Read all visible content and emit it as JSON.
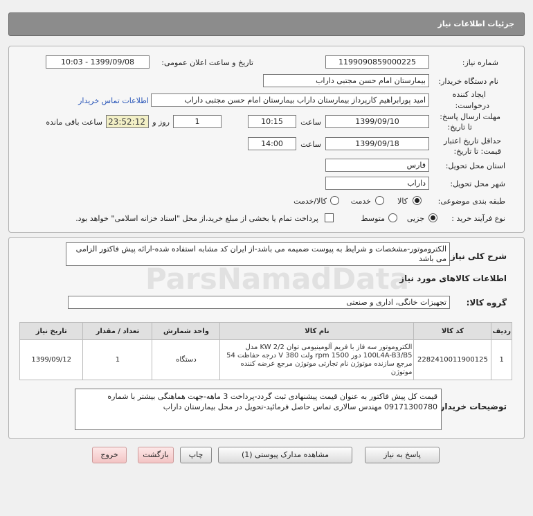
{
  "header": {
    "title": "جزئیات اطلاعات نیاز"
  },
  "form": {
    "need_number_label": "شماره نیاز:",
    "need_number": "1199090859000225",
    "announce_label": "تاریخ و ساعت اعلان عمومی:",
    "announce_value": "1399/09/08 - 10:03",
    "buyer_org_label": "نام دستگاه خریدار:",
    "buyer_org": "بیمارستان امام حسن مجتبی داراب",
    "creator_label_1": "ایجاد کننده",
    "creator_label_2": "درخواست:",
    "creator": "امید پورابراهیم کارپرداز بیمارستان داراب بیمارستان امام حسن مجتبی داراب",
    "contact_link": "اطلاعات تماس خریدار",
    "send_deadline_label_1": "مهلت ارسال پاسخ:",
    "send_deadline_label_2": "تا تاریخ:",
    "send_date": "1399/09/10",
    "time_label": "ساعت",
    "send_time": "10:15",
    "days_value": "1",
    "days_label": "روز و",
    "remaining_time": "23:52:12",
    "remaining_label": "ساعت باقی مانده",
    "validity_label_1": "حداقل تاریخ اعتبار",
    "validity_label_2": "قیمت: تا تاریخ:",
    "validity_date": "1399/09/18",
    "validity_time": "14:00",
    "province_label": "استان محل تحویل:",
    "province": "فارس",
    "city_label": "شهر محل تحویل:",
    "city": "داراب",
    "category_label": "طبقه بندی موضوعی:",
    "category_options": [
      "کالا",
      "خدمت",
      "کالا/خدمت"
    ],
    "category_selected": "کالا",
    "process_label": "نوع فرآیند خرید :",
    "process_options": [
      "جزیی",
      "متوسط"
    ],
    "process_selected": "جزیی",
    "payment_note": "پرداخت تمام یا بخشی از مبلغ خرید،از محل \"اسناد خزانه اسلامی\" خواهد بود."
  },
  "description": {
    "label": "شرح کلی نیاز:",
    "text": "الکتروموتور-مشخصات و شرایط به پیوست ضمیمه می باشد-از ایران کد مشابه استفاده شده-ارائه پیش فاکتور الزامی می باشد"
  },
  "goods": {
    "section_title": "اطلاعات کالاهای مورد نیاز",
    "group_label": "گروه کالا:",
    "group_value": "تجهیزات خانگی، اداری و صنعتی",
    "columns": [
      "ردیف",
      "کد کالا",
      "نام کالا",
      "واحد شمارش",
      "تعداد / مقدار",
      "تاریخ نیاز"
    ],
    "rows": [
      {
        "row": "1",
        "code": "2282410011900125",
        "name": "الکتروموتور سه فاز با فریم آلومینیومی توان KW 2/2 مدل 100L4A-B3/B5 دور rpm 1500 ولت V 380 درجه حفاظت 54 مرجع سازنده موتوژن نام تجارتی موتوژن مرجع عرضه کننده موتوژن",
        "unit": "دستگاه",
        "qty": "1",
        "date": "1399/09/12"
      }
    ]
  },
  "buyer_notes": {
    "label": "توضیحات خریدار:",
    "text": "قیمت کل پیش فاکتور به عنوان قیمت پیشنهادی ثبت گردد-پرداخت 3 ماهه-جهت هماهنگی بیشتر با شماره 09171300780 مهندس سالاری تماس حاصل فرمائید-تحویل در محل بیمارستان داراب"
  },
  "buttons": {
    "reply": "پاسخ به نیاز",
    "attachments": "مشاهده مدارک پیوستی (1)",
    "print": "چاپ",
    "back": "بازگشت",
    "exit": "خروج"
  },
  "watermark": {
    "text": "ParsNamadData"
  },
  "colors": {
    "header_bg": "#8c8c8c",
    "timer_bg": "#f3f0c6",
    "link": "#2a56b8",
    "pink_button": "#f3c4c4"
  }
}
